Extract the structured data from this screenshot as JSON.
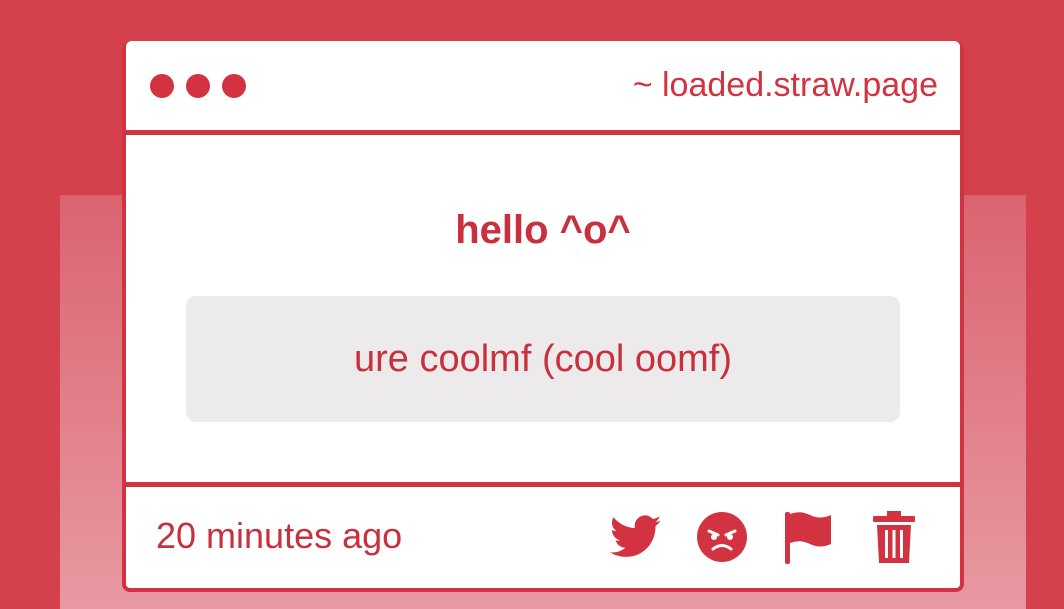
{
  "window": {
    "url": "~ loaded.straw.page"
  },
  "post": {
    "title": "hello ^o^",
    "message": "ure coolmf (cool oomf)",
    "timestamp": "20 minutes ago"
  },
  "actions": [
    {
      "icon": "twitter-icon"
    },
    {
      "icon": "angry-face-icon"
    },
    {
      "icon": "flag-icon"
    },
    {
      "icon": "trash-icon"
    }
  ],
  "colors": {
    "background": "#d4404b",
    "accent": "#d33341",
    "message_box": "#edeaeb",
    "card": "#ffffff"
  }
}
